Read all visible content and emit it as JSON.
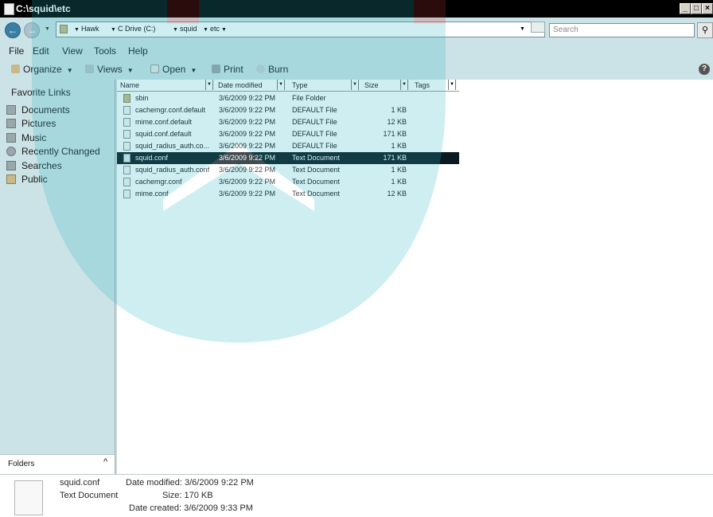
{
  "window": {
    "title": "C:\\squid\\etc",
    "minimize": "_",
    "maximize": "□",
    "close": "×"
  },
  "address": {
    "crumbs": [
      "Hawk",
      "C Drive (C:)",
      "squid",
      "etc"
    ],
    "search_placeholder": "Search"
  },
  "menubar": [
    "File",
    "Edit",
    "View",
    "Tools",
    "Help"
  ],
  "toolbar": [
    "Organize",
    "Views",
    "Open",
    "Print",
    "Burn"
  ],
  "nav": {
    "heading": "Favorite Links",
    "items": [
      "Documents",
      "Pictures",
      "Music",
      "Recently Changed",
      "Searches",
      "Public"
    ],
    "folders_label": "Folders"
  },
  "columns": [
    "Name",
    "Date modified",
    "Type",
    "Size",
    "Tags"
  ],
  "files": [
    {
      "name": "sbin",
      "date": "3/6/2009 9:22 PM",
      "type": "File Folder",
      "size": ""
    },
    {
      "name": "cachemgr.conf.default",
      "date": "3/6/2009 9:22 PM",
      "type": "DEFAULT File",
      "size": "1 KB"
    },
    {
      "name": "mime.conf.default",
      "date": "3/6/2009 9:22 PM",
      "type": "DEFAULT File",
      "size": "12 KB"
    },
    {
      "name": "squid.conf.default",
      "date": "3/6/2009 9:22 PM",
      "type": "DEFAULT File",
      "size": "171 KB"
    },
    {
      "name": "squid_radius_auth.co...",
      "date": "3/6/2009 9:22 PM",
      "type": "DEFAULT File",
      "size": "1 KB"
    },
    {
      "name": "squid.conf",
      "date": "3/6/2009 9:22 PM",
      "type": "Text Document",
      "size": "171 KB"
    },
    {
      "name": "squid_radius_auth.conf",
      "date": "3/6/2009 9:22 PM",
      "type": "Text Document",
      "size": "1 KB"
    },
    {
      "name": "cachemgr.conf",
      "date": "3/6/2009 9:22 PM",
      "type": "Text Document",
      "size": "1 KB"
    },
    {
      "name": "mime.conf",
      "date": "3/6/2009 9:22 PM",
      "type": "Text Document",
      "size": "12 KB"
    }
  ],
  "selected_file": "squid.conf",
  "details": {
    "name": "squid.conf",
    "type": "Text Document",
    "date_modified": "Date modified: 3/6/2009 9:22 PM",
    "size": "Size: 170 KB",
    "date_created": "Date created: 3/6/2009 9:33 PM"
  },
  "colors": {
    "accent_band": "#cbe3e6",
    "selection": "#0b1a20",
    "titlebar": "#000000",
    "watermark": "#5bc4d0"
  }
}
